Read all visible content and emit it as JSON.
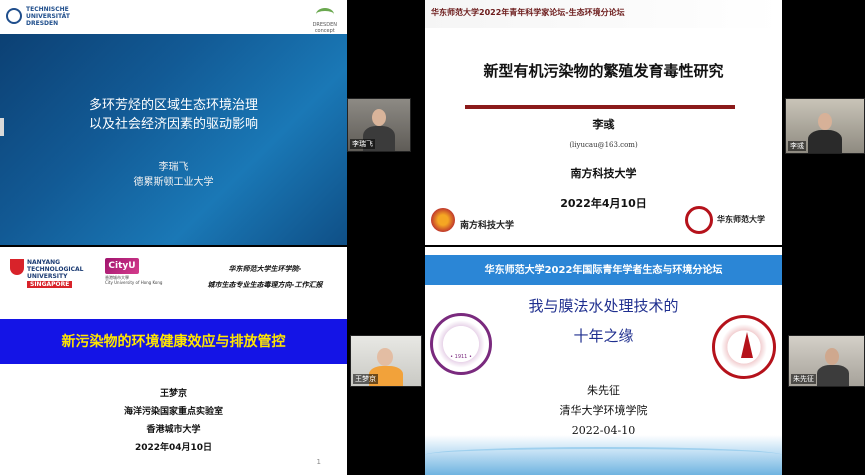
{
  "slide1": {
    "logo_left": "TECHNISCHE\nUNIVERSITÄT\nDRESDEN",
    "logo_right": "DRESDEN\nconcept",
    "title_line1": "多环芳烃的区域生态环境治理",
    "title_line2": "以及社会经济因素的驱动影响",
    "speaker": "李瑞飞",
    "affiliation": "德累斯顿工业大学"
  },
  "slide2": {
    "forum": "华东师范大学2022年青年科学家论坛-生态环境分论坛",
    "title": "新型有机污染物的繁殖发育毒性研究",
    "speaker": "李彧",
    "email": "(liyucau@163.com)",
    "university": "南方科技大学",
    "date": "2022年4月10日",
    "logo_left_text": "南方科技大学",
    "logo_right_text": "华东师范大学"
  },
  "slide3": {
    "ntu_text": "NANYANG\nTECHNOLOGICAL\nUNIVERSITY",
    "ntu_sg": "SINGAPORE",
    "cityu_badge": "CityU",
    "cityu_sub": "香港城市大學\nCity University of Hong Kong",
    "school_line1": "华东师范大学生环学院-",
    "school_line2": "城市生态专业生态毒理方向-工作汇报",
    "title": "新污染物的环境健康效应与排放管控",
    "speaker": "王梦京",
    "lab": "海洋污染国家重点实验室",
    "university": "香港城市大学",
    "date": "2022年04月10日",
    "page": "1"
  },
  "slide4": {
    "forum": "华东师范大学2022年国际青年学者生态与环境分论坛",
    "title_line1": "我与膜法水处理技术的",
    "title_line2": "十年之缘",
    "speaker": "朱先征",
    "affiliation": "清华大学环境学院",
    "date": "2022-04-10",
    "seal_year": "• 1911 •"
  },
  "participants": {
    "p1": "李瑞飞",
    "p2": "李彧",
    "p3": "王梦京",
    "p4": "朱先征"
  }
}
